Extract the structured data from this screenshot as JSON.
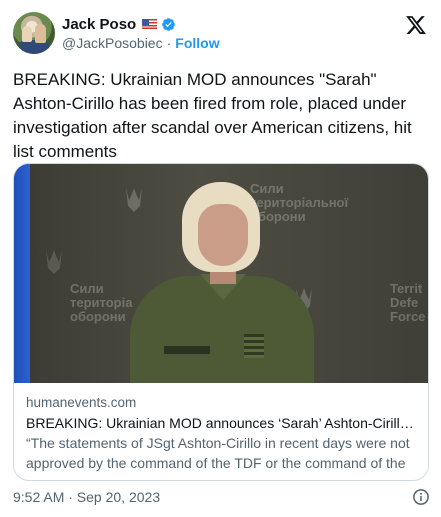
{
  "author": {
    "display_name": "Jack Poso",
    "flag_emoji": "🇺🇸",
    "handle": "@JackPosobiec",
    "separator": "·",
    "follow_label": "Follow",
    "verified_color": "#1d9bf0"
  },
  "icons": {
    "platform_logo": "x-logo-icon",
    "verified": "verified-badge-icon",
    "info": "info-icon"
  },
  "tweet": {
    "text": "BREAKING: Ukrainian MOD announces \"Sarah\" Ashton-Cirillo has been fired from role, placed under investigation after scandal over American citizens, hit list comments",
    "timestamp": "9:52 AM · Sep 20, 2023"
  },
  "link_card": {
    "image_wall_text_left": "Сили\nтериторіа\nоборони",
    "image_wall_text_top": "Сили\nтериторіальної\nоборони",
    "image_wall_text_right": "Territ\nDefe\nForce",
    "domain": "humanevents.com",
    "title": "BREAKING: Ukrainian MOD announces ‘Sarah’ Ashton-Cirillo h...",
    "description": "“The statements of JSgt Ashton-Cirillo in recent days were not approved by the command of the TDF or the command of the ..."
  },
  "colors": {
    "text_primary": "#0f1419",
    "text_secondary": "#536471",
    "link_blue": "#1d9bf0",
    "border": "#cfd9de"
  }
}
